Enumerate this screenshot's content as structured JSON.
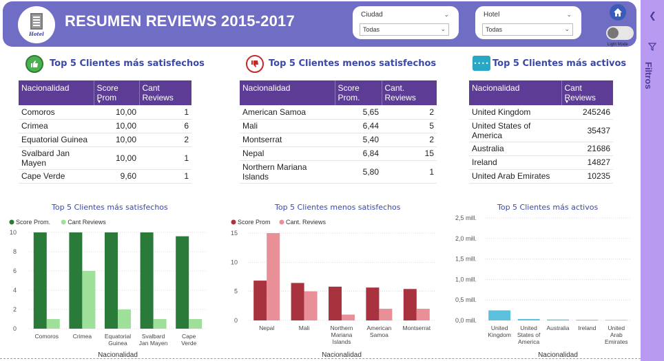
{
  "header": {
    "title": "RESUMEN REVIEWS 2015-2017",
    "logo_text": "Hotel",
    "slicer_city": {
      "label": "Ciudad",
      "value": "Todas"
    },
    "slicer_hotel": {
      "label": "Hotel",
      "value": "Todas"
    },
    "toggle_label": "Light Mode"
  },
  "sidebar": {
    "label": "Filtros"
  },
  "colors": {
    "header_bg": "#6f6ec4",
    "table_header": "#5d3c96",
    "dark_green": "#2a7a3a",
    "light_green": "#9ee09a",
    "dark_red": "#a8323d",
    "light_red": "#e98f98",
    "cyan": "#5bc0de"
  },
  "tables": {
    "satisfied": {
      "title": "Top 5 Clientes más satisfechos",
      "headers": [
        "Nacionalidad",
        "Score Prom",
        "Cant Reviews"
      ],
      "rows": [
        [
          "Comoros",
          "10,00",
          "1"
        ],
        [
          "Crimea",
          "10,00",
          "6"
        ],
        [
          "Equatorial Guinea",
          "10,00",
          "2"
        ],
        [
          "Svalbard Jan Mayen",
          "10,00",
          "1"
        ],
        [
          "Cape Verde",
          "9,60",
          "1"
        ]
      ]
    },
    "unsatisfied": {
      "title": "Top 5 Clientes menos satisfechos",
      "headers": [
        "Nacionalidad",
        "Score Prom.",
        "Cant. Reviews"
      ],
      "rows": [
        [
          "American Samoa",
          "5,65",
          "2"
        ],
        [
          "Mali",
          "6,44",
          "5"
        ],
        [
          "Montserrat",
          "5,40",
          "2"
        ],
        [
          "Nepal",
          "6,84",
          "15"
        ],
        [
          "Northern Mariana Islands",
          "5,80",
          "1"
        ]
      ]
    },
    "active": {
      "title": "Top 5 Clientes más activos",
      "headers": [
        "Nacionalidad",
        "Cant Reviews"
      ],
      "rows": [
        [
          "United Kingdom",
          "245246"
        ],
        [
          "United States of America",
          "35437"
        ],
        [
          "Australia",
          "21686"
        ],
        [
          "Ireland",
          "14827"
        ],
        [
          "United Arab Emirates",
          "10235"
        ]
      ]
    }
  },
  "chart_data": [
    {
      "type": "bar",
      "title": "Top 5 Clientes más satisfechos",
      "xlabel": "Nacionalidad",
      "categories": [
        "Comoros",
        "Crimea",
        "Equatorial Guinea",
        "Svalbard Jan Mayen",
        "Cape Verde"
      ],
      "series": [
        {
          "name": "Score Prom.",
          "values": [
            10,
            10,
            10,
            10,
            9.6
          ],
          "color": "#2a7a3a"
        },
        {
          "name": "Cant Reviews",
          "values": [
            1,
            6,
            2,
            1,
            1
          ],
          "color": "#9ee09a"
        }
      ],
      "yticks": [
        "0",
        "2",
        "4",
        "6",
        "8",
        "10"
      ],
      "ylim": [
        0,
        10
      ],
      "legend": "top-left"
    },
    {
      "type": "bar",
      "title": "Top 5 Clientes menos satisfechos",
      "xlabel": "Nacionalidad",
      "categories": [
        "Nepal",
        "Mali",
        "Northern Mariana Islands",
        "American Samoa",
        "Montserrat"
      ],
      "series": [
        {
          "name": "Score Prom",
          "values": [
            6.84,
            6.44,
            5.8,
            5.65,
            5.4
          ],
          "color": "#a8323d"
        },
        {
          "name": "Cant. Reviews",
          "values": [
            15,
            5,
            1,
            2,
            2
          ],
          "color": "#e98f98"
        }
      ],
      "yticks": [
        "0",
        "5",
        "10",
        "15"
      ],
      "ylim": [
        0,
        15
      ],
      "legend": "top-left"
    },
    {
      "type": "bar",
      "title": "Top 5 Clientes más activos",
      "xlabel": "Nacionalidad",
      "categories": [
        "United Kingdom",
        "United States of America",
        "Australia",
        "Ireland",
        "United Arab Emirates"
      ],
      "series": [
        {
          "values": [
            245246,
            35437,
            21686,
            14827,
            10235
          ],
          "color": "#5bc0de"
        }
      ],
      "yticks": [
        "0,0 mill.",
        "0,5 mill.",
        "1,0 mill.",
        "1,5 mill.",
        "2,0 mill.",
        "2,5 mill."
      ],
      "ylim": [
        0,
        2500000
      ]
    }
  ]
}
